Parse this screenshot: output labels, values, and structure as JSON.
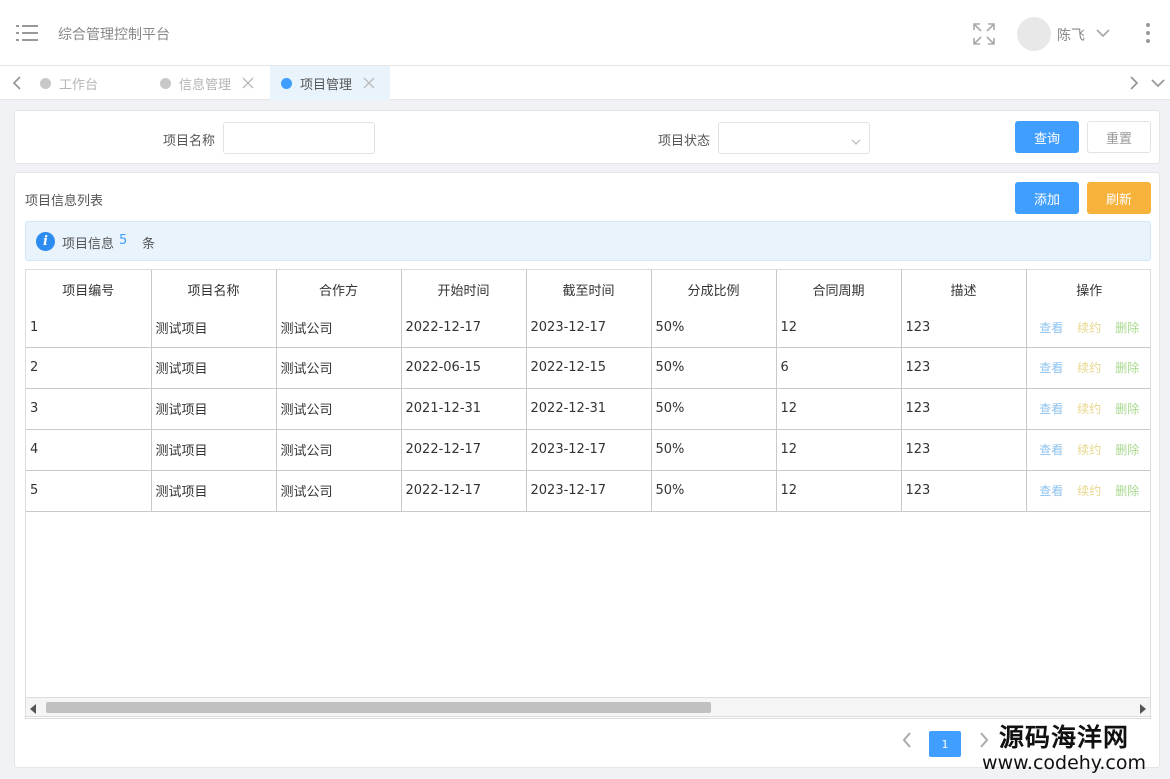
{
  "header": {
    "title": "综合管理控制平台",
    "user_name": "陈飞"
  },
  "tabs": [
    {
      "label": "工作台",
      "active": false,
      "closable": false
    },
    {
      "label": "信息管理",
      "active": false,
      "closable": true
    },
    {
      "label": "项目管理",
      "active": true,
      "closable": true
    }
  ],
  "search": {
    "name_label": "项目名称",
    "name_value": "",
    "status_label": "项目状态",
    "status_value": "",
    "query_button": "查询",
    "reset_button": "重置"
  },
  "list": {
    "title": "项目信息列表",
    "add_button": "添加",
    "refresh_button": "刷新",
    "info_text": "项目信息",
    "info_count": "5",
    "info_unit": "条"
  },
  "table": {
    "columns": [
      "项目编号",
      "项目名称",
      "合作方",
      "开始时间",
      "截至时间",
      "分成比例",
      "合同周期",
      "描述",
      "操作"
    ],
    "rows": [
      [
        "1",
        "测试项目",
        "测试公司",
        "2022-12-17",
        "2023-12-17",
        "50%",
        "12",
        "123"
      ],
      [
        "2",
        "测试项目",
        "测试公司",
        "2022-06-15",
        "2022-12-15",
        "50%",
        "6",
        "123"
      ],
      [
        "3",
        "测试项目",
        "测试公司",
        "2021-12-31",
        "2022-12-31",
        "50%",
        "12",
        "123"
      ],
      [
        "4",
        "测试项目",
        "测试公司",
        "2022-12-17",
        "2023-12-17",
        "50%",
        "12",
        "123"
      ],
      [
        "5",
        "测试项目",
        "测试公司",
        "2022-12-17",
        "2023-12-17",
        "50%",
        "12",
        "123"
      ]
    ],
    "actions": {
      "view": "查看",
      "renew": "续约",
      "delete": "删除"
    }
  },
  "pagination": {
    "current_page": "1"
  },
  "watermark": {
    "text": "源码海洋网",
    "url": "www.codehy.com"
  },
  "colors": {
    "primary": "#409eff",
    "warning": "#f7b23b",
    "info_bg": "#e9f3fc"
  },
  "icons": [
    "menu-icon",
    "fullscreen-icon",
    "chevron-down-icon",
    "more-vertical-icon",
    "chevron-left-icon",
    "chevron-right-icon",
    "close-icon",
    "info-icon"
  ]
}
